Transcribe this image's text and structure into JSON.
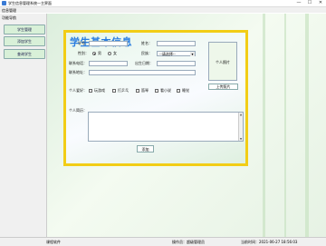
{
  "window": {
    "title": "学生信息管理系统—主界面",
    "minimize": "—",
    "maximize": "☐",
    "close": "✕"
  },
  "menu": {
    "items": [
      "信息管理"
    ]
  },
  "sidebar": {
    "title": "功能导航",
    "buttons": [
      "学生管理",
      "添加学生",
      "查询学生"
    ]
  },
  "form": {
    "heading": "学生基本信息",
    "student_id_label": "学号：",
    "student_id_value": "",
    "name_label": "姓名：",
    "name_value": "",
    "gender_label": "性别：",
    "gender_options": [
      "男",
      "女"
    ],
    "gender_selected": "男",
    "ethnicity_label": "民族：",
    "ethnicity_value": "--请选择--",
    "phone_label": "联系电话：",
    "phone_value": "",
    "birthdate_label": "出生日期：",
    "birthdate_value": "",
    "address_label": "联系地址：",
    "address_value": "",
    "photo_label": "个人照片",
    "upload_label": "上传照片",
    "hobbies_label": "个人爱好：",
    "hobbies": [
      "玩游戏",
      "打乒乓",
      "笛琴",
      "看小说",
      "睡觉"
    ],
    "intro_label": "个人简历：",
    "intro_value": "",
    "add_button": "添加"
  },
  "status": {
    "section_label": "课程软件",
    "operator_label": "操作员：超级管理员",
    "time_label": "当前时间：2021-06-27 18:56:03"
  },
  "colors": {
    "heading": "#2a7de0",
    "panel_border": "#f2cd16",
    "sidebar_button": "#d8f0d8"
  }
}
